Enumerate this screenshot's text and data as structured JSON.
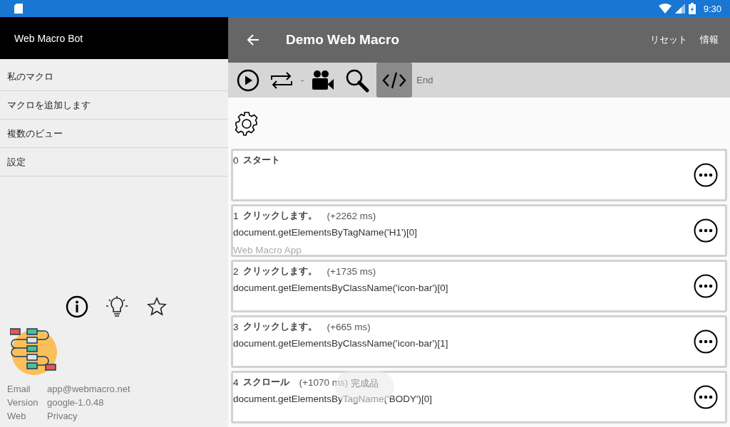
{
  "status_bar": {
    "time": "9:30"
  },
  "drawer": {
    "header": "Web Macro Bot",
    "items": [
      {
        "label": "私のマクロ"
      },
      {
        "label": "マクロを追加します"
      },
      {
        "label": "複数のビュー"
      },
      {
        "label": "設定"
      }
    ],
    "info": [
      {
        "key": "Email",
        "value": "app@webmacro.net"
      },
      {
        "key": "Version",
        "value": "google-1.0.48"
      },
      {
        "key": "Web",
        "value": "Privacy"
      }
    ]
  },
  "app_bar": {
    "title": "Demo Web Macro",
    "actions": [
      "リセット",
      "情報"
    ]
  },
  "toolbar": {
    "tools": [
      {
        "kind": "play",
        "selected": false
      },
      {
        "kind": "repeat",
        "selected": false
      },
      {
        "kind": "dash",
        "text": "-"
      },
      {
        "kind": "camera",
        "selected": false
      },
      {
        "kind": "search",
        "selected": false
      },
      {
        "kind": "code",
        "selected": true
      },
      {
        "kind": "label",
        "text": "End"
      }
    ]
  },
  "steps": [
    {
      "number": "0",
      "title": "スタート"
    },
    {
      "number": "1",
      "title": "クリックします。",
      "delay": "(+2262 ms)",
      "code": "document.getElementsByTagName('H1')[0]",
      "note": "Web Macro App"
    },
    {
      "number": "2",
      "title": "クリックします。",
      "delay": "(+1735 ms)",
      "code": "document.getElementsByClassName('icon-bar')[0]"
    },
    {
      "number": "3",
      "title": "クリックします。",
      "delay": "(+665 ms)",
      "code": "document.getElementsByClassName('icon-bar')[1]"
    },
    {
      "number": "4",
      "title": "スクロール",
      "delay": "(+1070 ms)",
      "code": "document.getElementsByTagName('BODY')[0]"
    }
  ],
  "toast": "完成品"
}
